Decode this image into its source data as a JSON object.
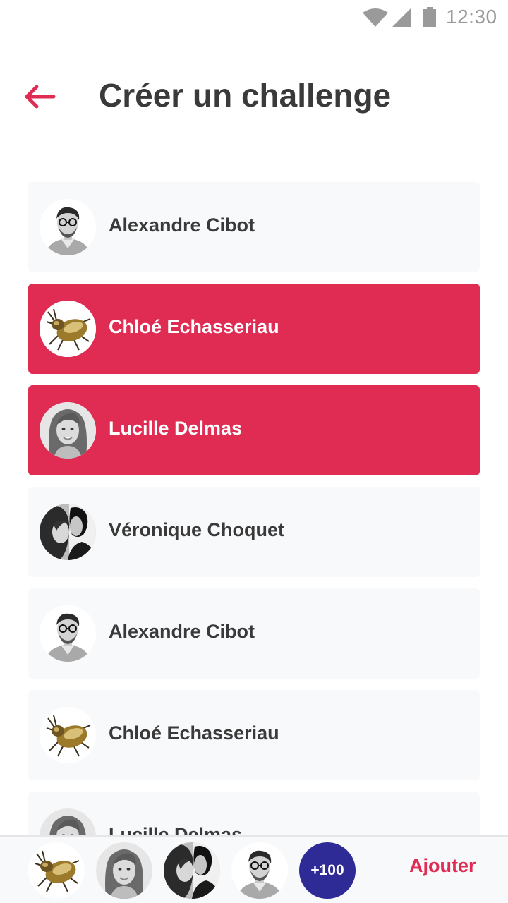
{
  "status_bar": {
    "time": "12:30",
    "icons": [
      "wifi-icon",
      "signal-icon",
      "battery-icon"
    ]
  },
  "header": {
    "back_icon": "arrow-left-icon",
    "title": "Créer un challenge"
  },
  "contacts": [
    {
      "name": "Alexandre Cibot",
      "avatar": "man-glasses-portrait",
      "selected": false
    },
    {
      "name": "Chloé Echasseriau",
      "avatar": "beetle-photo",
      "selected": true
    },
    {
      "name": "Lucille Delmas",
      "avatar": "woman-portrait",
      "selected": true
    },
    {
      "name": "Véronique Choquet",
      "avatar": "couple-portrait",
      "selected": false
    },
    {
      "name": "Alexandre Cibot",
      "avatar": "man-glasses-portrait",
      "selected": false
    },
    {
      "name": "Chloé Echasseriau",
      "avatar": "beetle-photo",
      "selected": false
    },
    {
      "name": "Lucille Delmas",
      "avatar": "woman-portrait",
      "selected": false
    }
  ],
  "bottom_bar": {
    "selected_avatars": [
      "beetle-photo",
      "woman-portrait",
      "couple-portrait",
      "man-glasses-portrait"
    ],
    "more_count": "+100",
    "add_label": "Ajouter"
  },
  "colors": {
    "accent": "#e02b53",
    "badge": "#2e2a96",
    "row_background": "#f8f9fb",
    "title_text": "#3a3a3a"
  }
}
